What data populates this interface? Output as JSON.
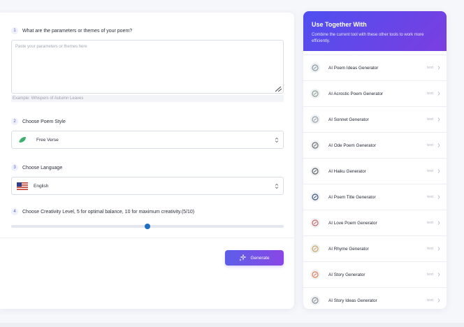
{
  "form": {
    "step1": {
      "num": "1",
      "label": "What are the parameters or themes of your poem?",
      "placeholder": "Paste your parameters or themes here",
      "example": "Example:  Whispers of Autumn Leaves"
    },
    "step2": {
      "num": "2",
      "label": "Choose Poem Style",
      "value": "Free Verse"
    },
    "step3": {
      "num": "3",
      "label": "Choose Language",
      "value": "English"
    },
    "step4": {
      "num": "4",
      "label": "Choose Creativity Level, 5 for optimal balance, 10 for maximum creativity.(5/10)",
      "creativity_value": 5,
      "creativity_max": 10
    },
    "generate_label": "Generate"
  },
  "sidebar": {
    "title": "Use Together With",
    "description": "Combine the current tool with these other tools to work more efficiently.",
    "tools": [
      {
        "name": "AI Poem Ideas Generator",
        "type": "text",
        "icon": "swirl-icon",
        "color": "#8a9aa8"
      },
      {
        "name": "AI Acrostic Poem Generator",
        "type": "text",
        "icon": "feather-icon",
        "color": "#8fa095"
      },
      {
        "name": "AI Sonnet Generator",
        "type": "text",
        "icon": "swirl-icon",
        "color": "#9aa3ab"
      },
      {
        "name": "AI Ode Poem Generator",
        "type": "text",
        "icon": "quill-icon",
        "color": "#6d6f73"
      },
      {
        "name": "AI Haiku Generator",
        "type": "text",
        "icon": "character-icon",
        "color": "#5f6165"
      },
      {
        "name": "AI Poem Title Generator",
        "type": "text",
        "icon": "quill-ink-icon",
        "color": "#3f5a80"
      },
      {
        "name": "AI Love Poem Generator",
        "type": "text",
        "icon": "heart-icon",
        "color": "#c76a6a"
      },
      {
        "name": "AI Rhyme Generator",
        "type": "text",
        "icon": "scroll-icon",
        "color": "#c9a86a"
      },
      {
        "name": "AI Story Generator",
        "type": "text",
        "icon": "book-icon",
        "color": "#e0825a"
      },
      {
        "name": "AI Story Ideas Generator",
        "type": "text",
        "icon": "book-stack-icon",
        "color": "#8a8f96"
      }
    ]
  },
  "colors": {
    "accent": "#5b5ee8",
    "accent2": "#8a46e6",
    "slider_thumb": "#1f6fc5"
  }
}
